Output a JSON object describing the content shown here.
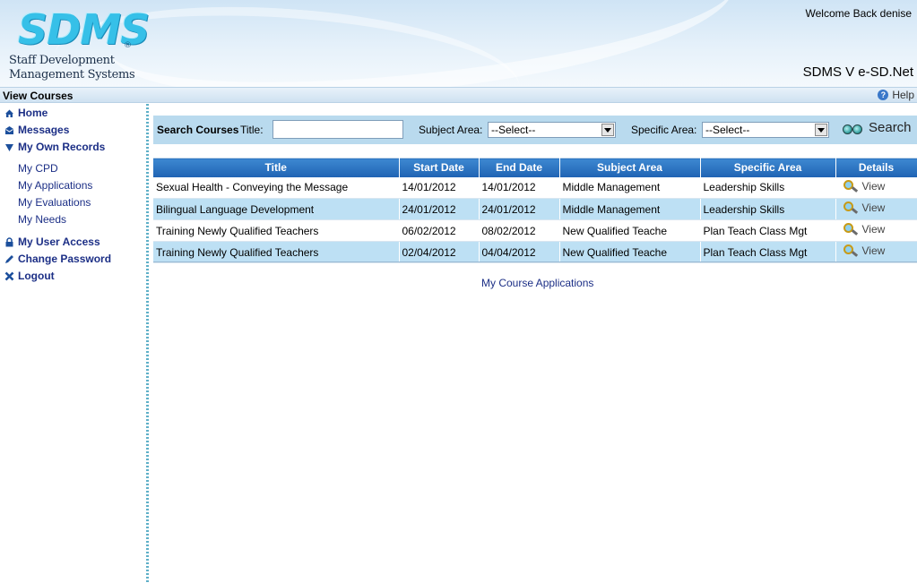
{
  "header": {
    "logo_text": "SDMS",
    "logo_reg": "®",
    "logo_line1": "Staff Development",
    "logo_line2": "Management Systems",
    "welcome": "Welcome Back denise",
    "version": "SDMS V e-SD.Net"
  },
  "titlebar": {
    "page_title": "View Courses",
    "help_label": "Help",
    "help_icon_glyph": "?"
  },
  "sidebar": {
    "home": "Home",
    "messages": "Messages",
    "my_own_records": "My Own Records",
    "sub_items": [
      "My CPD",
      "My Applications",
      "My Evaluations",
      "My Needs"
    ],
    "my_user_access": "My User Access",
    "change_password": "Change Password",
    "logout": "Logout"
  },
  "search": {
    "section_label": "Search Courses",
    "title_label": "Title:",
    "title_value": "",
    "subject_label": "Subject Area:",
    "subject_selected": "--Select--",
    "specific_label": "Specific Area:",
    "specific_selected": "--Select--",
    "button_label": "Search"
  },
  "table": {
    "columns": [
      "Title",
      "Start Date",
      "End Date",
      "Subject Area",
      "Specific Area",
      "Details"
    ],
    "rows": [
      {
        "title": "Sexual Health - Conveying the Message",
        "start": "14/01/2012",
        "end": "14/01/2012",
        "subject": "Middle Management",
        "specific": "Leadership Skills",
        "details": "View"
      },
      {
        "title": "Bilingual Language Development",
        "start": "24/01/2012",
        "end": "24/01/2012",
        "subject": "Middle Management",
        "specific": "Leadership Skills",
        "details": "View"
      },
      {
        "title": "Training Newly Qualified Teachers",
        "start": "06/02/2012",
        "end": "08/02/2012",
        "subject": "New Qualified Teache",
        "specific": "Plan Teach Class Mgt",
        "details": "View"
      },
      {
        "title": "Training Newly Qualified Teachers",
        "start": "02/04/2012",
        "end": "04/04/2012",
        "subject": "New Qualified Teache",
        "specific": "Plan Teach Class Mgt",
        "details": "View"
      }
    ]
  },
  "footer": {
    "my_course_applications": "My Course Applications"
  },
  "colors": {
    "nav_text": "#1c2f86",
    "header_bar": "#1f63b3",
    "row_alt": "#bde0f4",
    "search_bar": "#b9daee"
  }
}
